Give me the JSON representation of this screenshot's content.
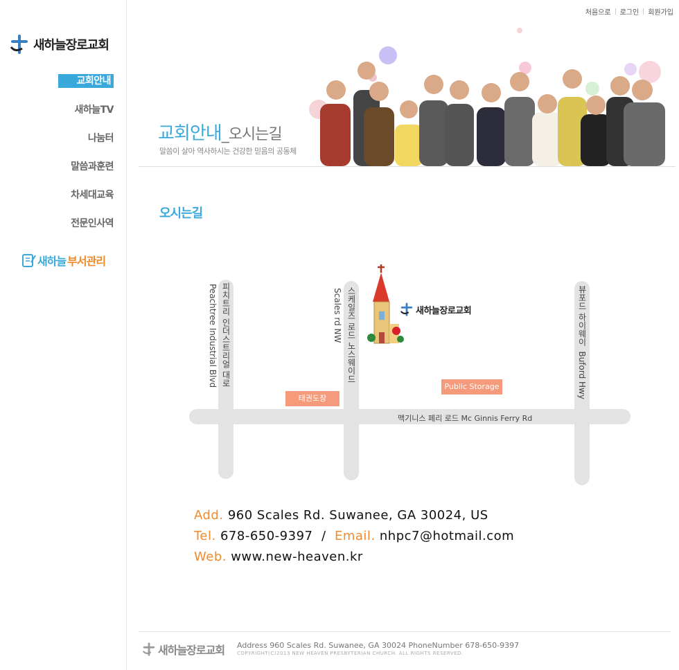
{
  "top_links": [
    "처음으로",
    "로그인",
    "회원가입"
  ],
  "logo": {
    "text": "새하늘장로교회"
  },
  "nav": [
    {
      "label": "교회안내"
    },
    {
      "label": "새하늘TV"
    },
    {
      "label": "나눔터"
    },
    {
      "label": "말씀과훈련"
    },
    {
      "label": "차세대교육"
    },
    {
      "label": "전문인사역"
    }
  ],
  "dept": {
    "part1": "새하늘",
    "part2": "부서관리"
  },
  "banner": {
    "title": "교회안내",
    "title_sub": "_오시는길",
    "subtitle": "말씀이 살아 역사하시는 건강한 믿음의 공동체"
  },
  "section_title": "오시는길",
  "map": {
    "church_name": "새하늘장로교회",
    "road_peachtree_ko": "피치트리 인더스트리얼 대로",
    "road_peachtree_en": "Peachtree Industrial Blvd",
    "road_scales_ko": "스케일즈 로드 노스웨이드",
    "road_scales_en": "Scales rd NW",
    "road_buford_ko": "뷰포드 하이웨이",
    "road_buford_en": "Buford Hwy",
    "road_mcginnis": "맥기니스 페리 로드  Mc Ginnis Ferry Rd",
    "tag_taekwondo": "태권도장",
    "tag_storage": "Public Storage"
  },
  "contact": {
    "add_label": "Add.",
    "add_value": "960 Scales Rd. Suwanee, GA 30024, US",
    "tel_label": "Tel.",
    "tel_value": "678-650-9397",
    "slash": "/",
    "email_label": "Email.",
    "email_value": "nhpc7@hotmail.com",
    "web_label": "Web.",
    "web_value": "www.new-heaven.kr"
  },
  "footer": {
    "logo_text": "새하늘장로교회",
    "address": "Address 960 Scales Rd. Suwanee, GA 30024 PhoneNumber 678-650-9397",
    "copyright": "COPYRIGHT(C)2013 NEW HEAVEN PRESBYTERIAN CHURCH. ALL RIGHTS RESERVED."
  },
  "colors": {
    "accent": "#39a9dc",
    "orange": "#f08a2a",
    "tag": "#f59a7a"
  }
}
